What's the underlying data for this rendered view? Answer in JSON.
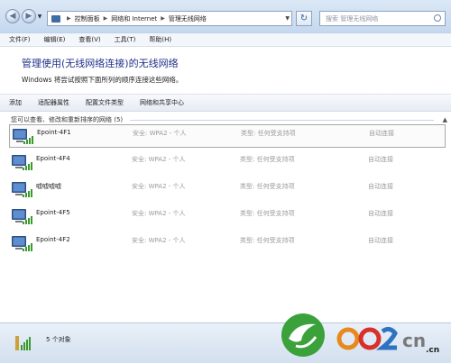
{
  "address_bar": {
    "crumbs": [
      "控制面板",
      "网络和 Internet",
      "管理无线网络"
    ]
  },
  "search": {
    "placeholder": "搜索 管理无线网络"
  },
  "menu": {
    "items": [
      "文件(F)",
      "编辑(E)",
      "查看(V)",
      "工具(T)",
      "帮助(H)"
    ]
  },
  "page": {
    "heading": "管理使用(无线网络连接)的无线网络",
    "subtext": "Windows 将尝试按照下面所列的顺序连接这些网络。"
  },
  "toolbar": {
    "items": [
      "添加",
      "适配器属性",
      "配置文件类型",
      "网络和共享中心"
    ]
  },
  "group": {
    "label": "您可以查看、修改和重新排序的网络 (5)"
  },
  "networks": [
    {
      "name": "Epoint-4F1",
      "security": "安全: WPA2 - 个人",
      "type": "类型: 任何受支持项",
      "auto": "自动连接"
    },
    {
      "name": "Epoint-4F4",
      "security": "安全: WPA2 - 个人",
      "type": "类型: 任何受支持项",
      "auto": "自动连接"
    },
    {
      "name": "嘘嘘嘘嘘",
      "security": "安全: WPA2 - 个人",
      "type": "类型: 任何受支持项",
      "auto": "自动连接"
    },
    {
      "name": "Epoint-4F5",
      "security": "安全: WPA2 - 个人",
      "type": "类型: 任何受支持项",
      "auto": "自动连接"
    },
    {
      "name": "Epoint-4F2",
      "security": "安全: WPA2 - 个人",
      "type": "类型: 任何受支持项",
      "auto": "自动连接"
    }
  ],
  "status": {
    "text": "5 个对象"
  },
  "watermark": {
    "text": "0 2 cn",
    "suffix": ".cn"
  },
  "colors": {
    "heading": "#1e3287",
    "frame": "#bcd3ea",
    "watermark_green": "#3aa13b"
  }
}
